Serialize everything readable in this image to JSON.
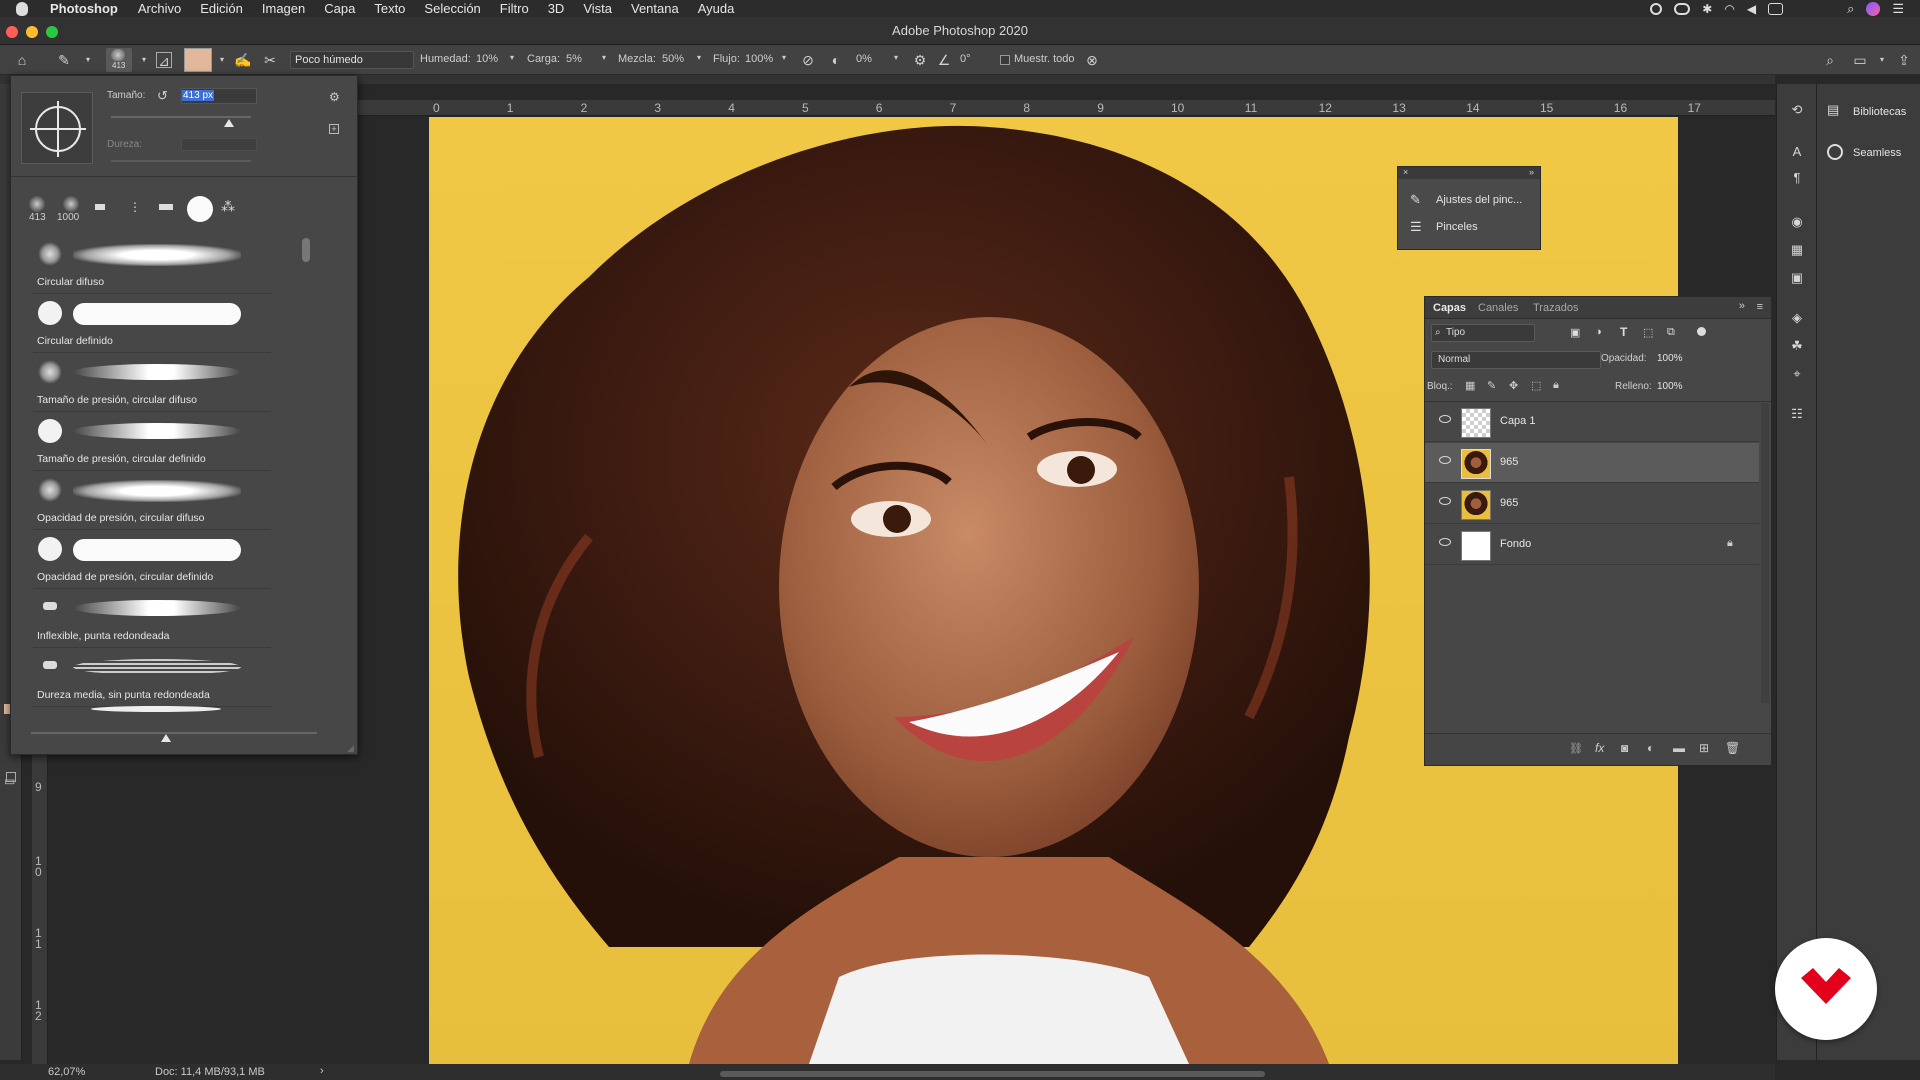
{
  "menubar": {
    "app_name": "Photoshop",
    "items": [
      "Archivo",
      "Edición",
      "Imagen",
      "Capa",
      "Texto",
      "Selección",
      "Filtro",
      "3D",
      "Vista",
      "Ventana",
      "Ayuda"
    ]
  },
  "window_title": "Adobe Photoshop 2020",
  "options": {
    "brush_size_badge": "413",
    "mode_preset": "Poco húmedo",
    "humedad_label": "Humedad:",
    "humedad_value": "10%",
    "carga_label": "Carga:",
    "carga_value": "5%",
    "mezcla_label": "Mezcla:",
    "mezcla_value": "50%",
    "flujo_label": "Flujo:",
    "flujo_value": "100%",
    "smoothing_value": "0%",
    "angle_value": "0°",
    "sample_all_label": "Muestr. todo"
  },
  "ruler": {
    "h_ticks": [
      "0",
      "1",
      "2",
      "3",
      "4",
      "5",
      "6",
      "7",
      "8",
      "9",
      "10",
      "11",
      "12",
      "13",
      "14",
      "15",
      "16",
      "17"
    ],
    "v_ticks": [
      "9",
      "1\n0",
      "1\n1",
      "1\n2"
    ]
  },
  "brush_panel": {
    "size_label": "Tamaño:",
    "size_value": "413 px",
    "hardness_label": "Dureza:",
    "recent_sizes": [
      "413",
      "1000"
    ],
    "brushes": [
      {
        "label": "Circular difuso",
        "style": "soft"
      },
      {
        "label": "Circular definido",
        "style": "hard"
      },
      {
        "label": "Tamaño de presión, circular difuso",
        "style": "taper-soft"
      },
      {
        "label": "Tamaño de presión, circular definido",
        "style": "taper-hard"
      },
      {
        "label": "Opacidad de presión, circular difuso",
        "style": "soft"
      },
      {
        "label": "Opacidad de presión, circular definido",
        "style": "hard"
      },
      {
        "label": "Inflexible, punta redondeada",
        "style": "taper-small"
      },
      {
        "label": "Dureza media, sin punta redondeada",
        "style": "bristle"
      }
    ]
  },
  "mini_panel": {
    "items": [
      "Ajustes del pinc...",
      "Pinceles"
    ]
  },
  "layers_panel": {
    "tabs": [
      "Capas",
      "Canales",
      "Trazados"
    ],
    "filter_kind": "Tipo",
    "blend_mode": "Normal",
    "opacity_label": "Opacidad:",
    "opacity_value": "100%",
    "lock_label": "Bloq.:",
    "fill_label": "Relleno:",
    "fill_value": "100%",
    "layers": [
      {
        "name": "Capa 1",
        "selected": false,
        "thumb": "transparent"
      },
      {
        "name": "965",
        "selected": true,
        "thumb": "photo"
      },
      {
        "name": "965",
        "selected": false,
        "thumb": "photo"
      },
      {
        "name": "Fondo",
        "selected": false,
        "thumb": "white",
        "locked": true
      }
    ]
  },
  "dock": {
    "libraries_label": "Bibliotecas",
    "seamless_label": "Seamless"
  },
  "status": {
    "zoom": "62,07%",
    "doc": "Doc: 11,4 MB/93,1 MB"
  },
  "colors": {
    "photo_bg": "#f0c845",
    "selection_hl": "#3d6fd6",
    "brand_red": "#e3001b"
  }
}
